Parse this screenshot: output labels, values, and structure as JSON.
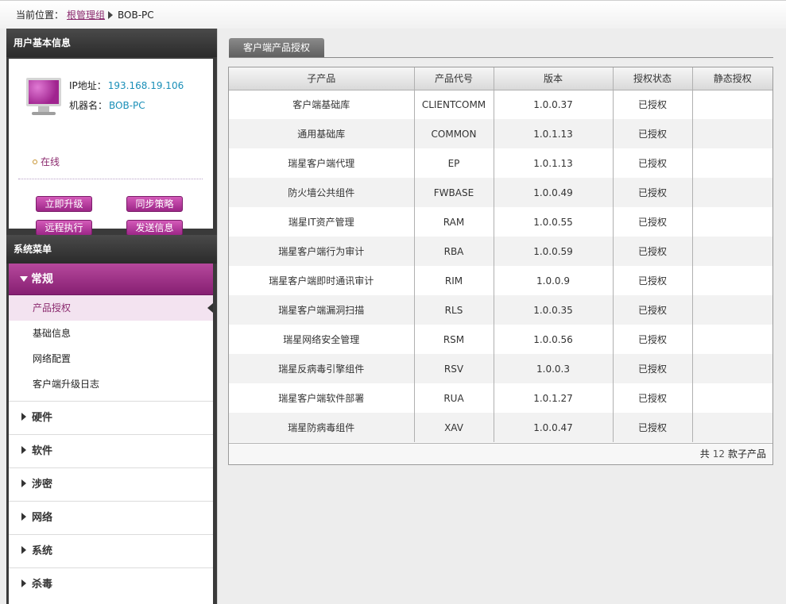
{
  "breadcrumb": {
    "label": "当前位置：",
    "root_link": "根管理组",
    "current": "BOB-PC"
  },
  "user_info": {
    "title": "用户基本信息",
    "ip_label": "IP地址：",
    "ip_value": "193.168.19.106",
    "host_label": "机器名：",
    "host_value": "BOB-PC",
    "status": "在线",
    "buttons": [
      "立即升级",
      "同步策略",
      "远程执行",
      "发送信息"
    ]
  },
  "menu": {
    "title": "系统菜单",
    "active_group": "常规",
    "active_items": [
      "产品授权",
      "基础信息",
      "网络配置",
      "客户端升级日志"
    ],
    "groups": [
      "硬件",
      "软件",
      "涉密",
      "网络",
      "系统",
      "杀毒"
    ]
  },
  "main": {
    "tab": "客户端产品授权",
    "columns": [
      "子产品",
      "产品代号",
      "版本",
      "授权状态",
      "静态授权"
    ],
    "rows": [
      [
        "客户端基础库",
        "CLIENTCOMM",
        "1.0.0.37",
        "已授权",
        ""
      ],
      [
        "通用基础库",
        "COMMON",
        "1.0.1.13",
        "已授权",
        ""
      ],
      [
        "瑞星客户端代理",
        "EP",
        "1.0.1.13",
        "已授权",
        ""
      ],
      [
        "防火墙公共组件",
        "FWBASE",
        "1.0.0.49",
        "已授权",
        ""
      ],
      [
        "瑞星IT资产管理",
        "RAM",
        "1.0.0.55",
        "已授权",
        ""
      ],
      [
        "瑞星客户端行为审计",
        "RBA",
        "1.0.0.59",
        "已授权",
        ""
      ],
      [
        "瑞星客户端即时通讯审计",
        "RIM",
        "1.0.0.9",
        "已授权",
        ""
      ],
      [
        "瑞星客户端漏洞扫描",
        "RLS",
        "1.0.0.35",
        "已授权",
        ""
      ],
      [
        "瑞星网络安全管理",
        "RSM",
        "1.0.0.56",
        "已授权",
        ""
      ],
      [
        "瑞星反病毒引擎组件",
        "RSV",
        "1.0.0.3",
        "已授权",
        ""
      ],
      [
        "瑞星客户端软件部署",
        "RUA",
        "1.0.1.27",
        "已授权",
        ""
      ],
      [
        "瑞星防病毒组件",
        "XAV",
        "1.0.0.47",
        "已授权",
        ""
      ]
    ],
    "footer_prefix": "共",
    "footer_count": "12",
    "footer_suffix": "款子产品"
  }
}
